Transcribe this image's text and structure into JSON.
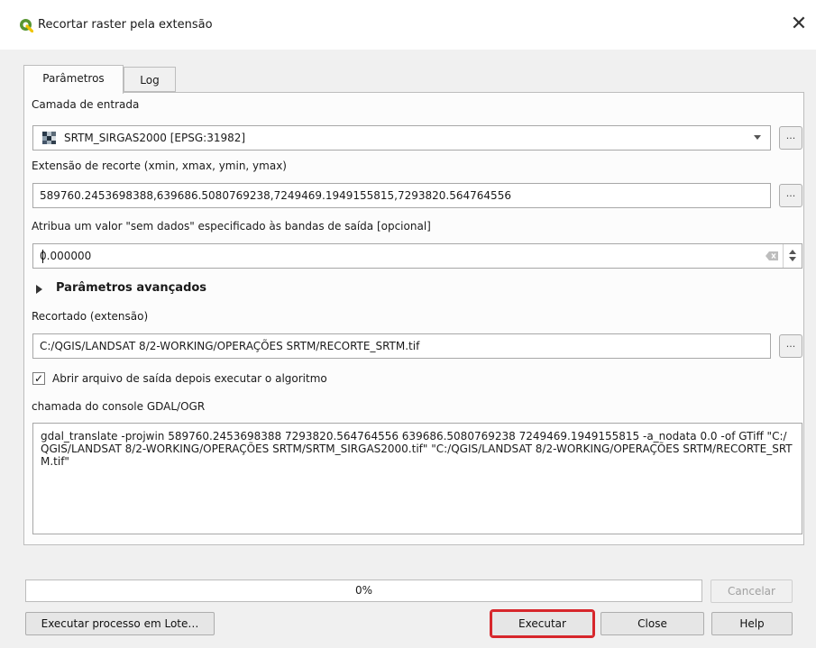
{
  "window": {
    "title": "Recortar raster pela extensão",
    "icon": "qgis-logo-icon",
    "close_icon": "close-icon"
  },
  "tabs": [
    {
      "label": "Parâmetros",
      "active": true
    },
    {
      "label": "Log",
      "active": false
    }
  ],
  "params": {
    "input_layer_label": "Camada de entrada",
    "input_layer_value": "SRTM_SIRGAS2000 [EPSG:31982]",
    "extent_label": "Extensão de recorte (xmin, xmax, ymin, ymax)",
    "extent_value": "589760.2453698388,639686.5080769238,7249469.1949155815,7293820.564764556",
    "nodata_label": "Atribua um valor \"sem dados\" especificado às bandas de saída [opcional]",
    "nodata_value": "0.000000",
    "advanced_label": "Parâmetros avançados",
    "output_label": "Recortado (extensão)",
    "output_value": "C:/QGIS/LANDSAT 8/2-WORKING/OPERAÇÕES SRTM/RECORTE_SRTM.tif",
    "open_output_label": "Abrir arquivo de saída depois executar o algoritmo",
    "open_output_checked": true,
    "console_label": "chamada do console GDAL/OGR",
    "console_value": "gdal_translate -projwin 589760.2453698388 7293820.564764556 639686.5080769238 7249469.1949155815 -a_nodata 0.0 -of GTiff \"C:/QGIS/LANDSAT 8/2-WORKING/OPERAÇÕES SRTM/SRTM_SIRGAS2000.tif\" \"C:/QGIS/LANDSAT 8/2-WORKING/OPERAÇÕES SRTM/RECORTE_SRTM.tif\"",
    "browse_label": "..."
  },
  "footer": {
    "progress_text": "0%",
    "progress_value": 0,
    "cancel_label": "Cancelar",
    "batch_label": "Executar processo em Lote…",
    "run_label": "Executar",
    "close_label": "Close",
    "help_label": "Help"
  },
  "colors": {
    "highlight": "#d7262b",
    "qgis_green": "#589632",
    "qgis_yellow": "#f0c500"
  }
}
